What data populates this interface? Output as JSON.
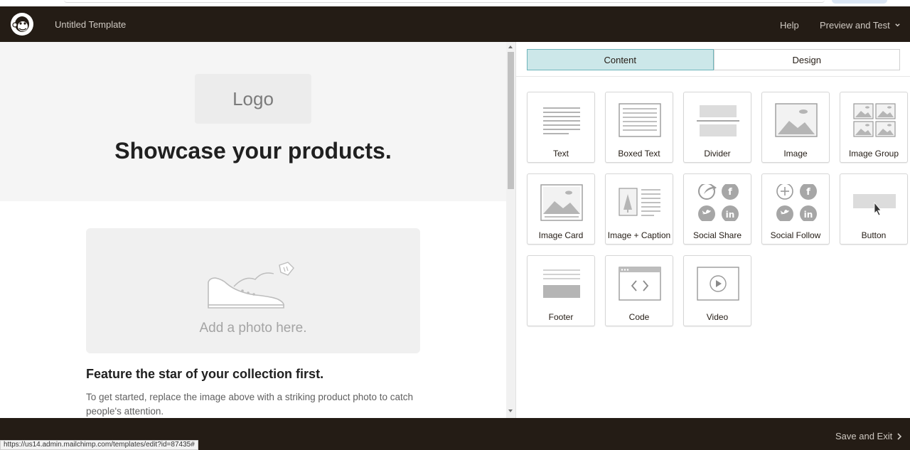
{
  "header": {
    "template_title": "Untitled Template",
    "help_label": "Help",
    "preview_label": "Preview and Test"
  },
  "canvas": {
    "logo_placeholder": "Logo",
    "hero_title": "Showcase your products.",
    "photo_placeholder": "Add a photo here.",
    "feature_title": "Feature the star of your collection first.",
    "feature_body": "To get started, replace the image above with a striking product photo to catch people's attention."
  },
  "panel": {
    "tabs": [
      {
        "label": "Content",
        "active": true
      },
      {
        "label": "Design",
        "active": false
      }
    ],
    "blocks": [
      {
        "label": "Text",
        "icon": "text-block-icon"
      },
      {
        "label": "Boxed Text",
        "icon": "boxed-text-icon"
      },
      {
        "label": "Divider",
        "icon": "divider-icon"
      },
      {
        "label": "Image",
        "icon": "image-icon"
      },
      {
        "label": "Image Group",
        "icon": "image-group-icon"
      },
      {
        "label": "Image Card",
        "icon": "image-card-icon"
      },
      {
        "label": "Image + Caption",
        "icon": "image-caption-icon"
      },
      {
        "label": "Social Share",
        "icon": "social-share-icon"
      },
      {
        "label": "Social Follow",
        "icon": "social-follow-icon"
      },
      {
        "label": "Button",
        "icon": "button-block-icon"
      },
      {
        "label": "Footer",
        "icon": "footer-icon"
      },
      {
        "label": "Code",
        "icon": "code-icon"
      },
      {
        "label": "Video",
        "icon": "video-icon"
      }
    ]
  },
  "footer": {
    "save_exit_label": "Save and Exit"
  },
  "status_bar": {
    "url": "https://us14.admin.mailchimp.com/templates/edit?id=87435#"
  },
  "colors": {
    "topbar": "#241c15",
    "active_tab": "#cce7e9",
    "active_tab_border": "#6fb5bb"
  }
}
